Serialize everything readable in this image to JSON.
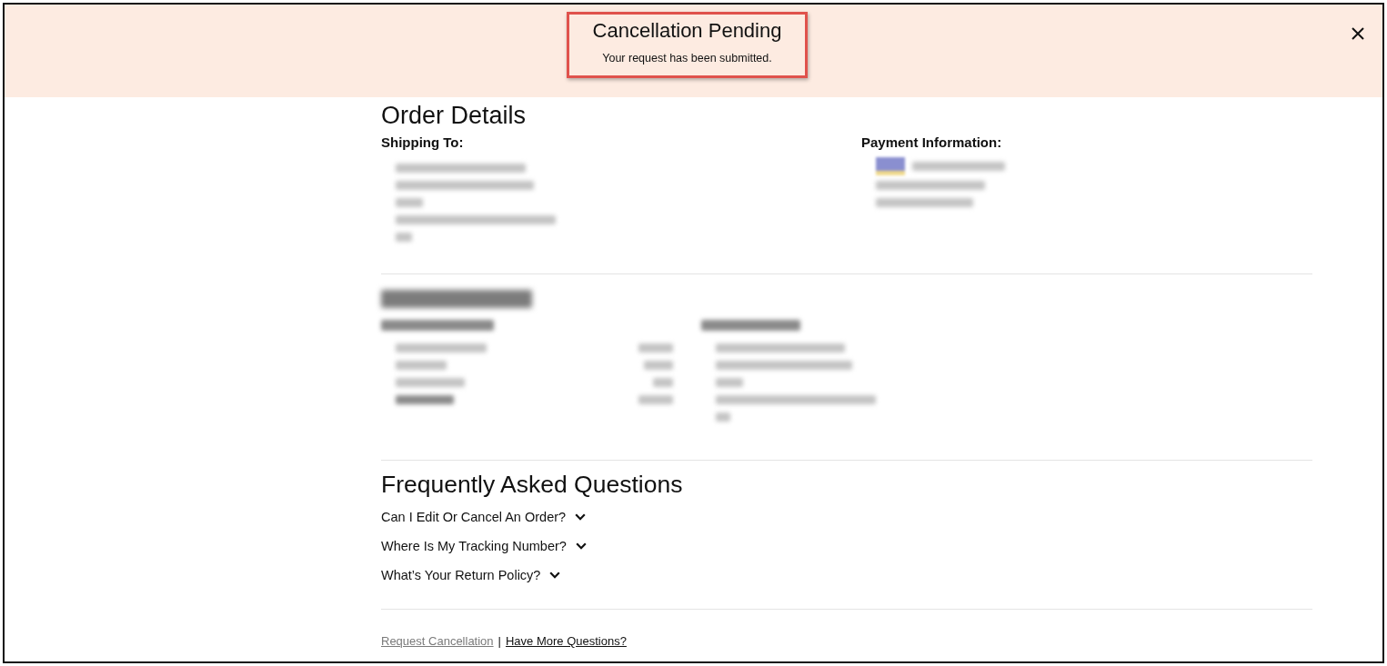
{
  "banner": {
    "title": "Cancellation Pending",
    "message": "Your request has been submitted.",
    "highlighted": true
  },
  "order_details": {
    "title": "Order Details",
    "shipping_label": "Shipping To:",
    "payment_label": "Payment Information:"
  },
  "faq": {
    "title": "Frequently Asked Questions",
    "items": [
      {
        "question": "Can I Edit Or Cancel An Order?",
        "expanded": false
      },
      {
        "question": "Where Is My Tracking Number?",
        "expanded": false
      },
      {
        "question": "What’s Your Return Policy?",
        "expanded": false
      }
    ]
  },
  "footer": {
    "links": [
      {
        "label": "Request Cancellation",
        "disabled": true
      },
      {
        "label": "Have More Questions?",
        "disabled": false
      }
    ],
    "separator": "|"
  }
}
